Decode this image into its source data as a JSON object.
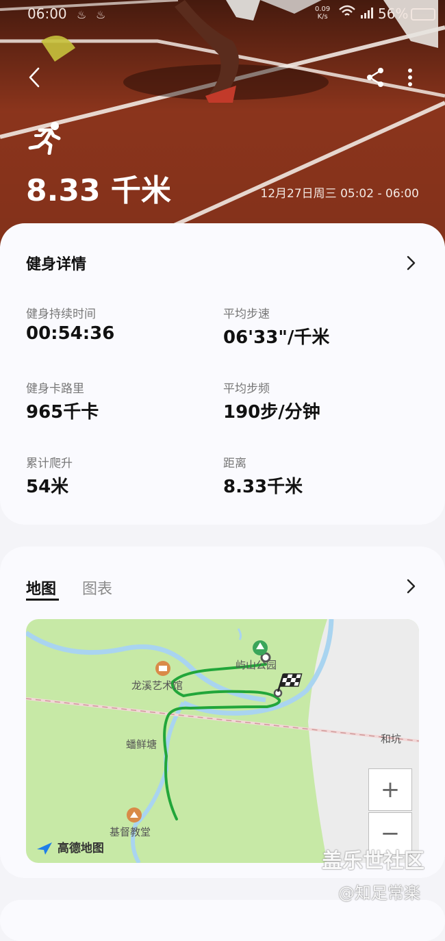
{
  "status_bar": {
    "time": "06:00",
    "net_speed_value": "0.09",
    "net_speed_unit": "K/s",
    "battery": "56%"
  },
  "header": {
    "distance": "8.33 千米",
    "date_range": "12月27日周三 05:02 - 06:00"
  },
  "details": {
    "title": "健身详情",
    "stats": [
      {
        "label": "健身持续时间",
        "value": "00:54:36"
      },
      {
        "label": "平均步速",
        "value": "06'33\"/千米"
      },
      {
        "label": "健身卡路里",
        "value": "965千卡"
      },
      {
        "label": "平均步频",
        "value": "190步/分钟"
      },
      {
        "label": "累计爬升",
        "value": "54米"
      },
      {
        "label": "距离",
        "value": "8.33千米"
      }
    ]
  },
  "map_section": {
    "tabs": [
      "地图",
      "图表"
    ],
    "active_tab": "地图",
    "places": [
      "屿山公园",
      "龙溪艺术馆",
      "和坑",
      "蟠鲜塘",
      "基督教堂"
    ],
    "provider": "高德地图",
    "zoom_in": "+",
    "zoom_out": "−"
  },
  "watermark": {
    "line1": "盖乐世社区",
    "line2": "@知足常楽"
  },
  "colors": {
    "route": "#22a63a",
    "map_bg": "#c7e9a6",
    "river": "#a9d4f0"
  }
}
